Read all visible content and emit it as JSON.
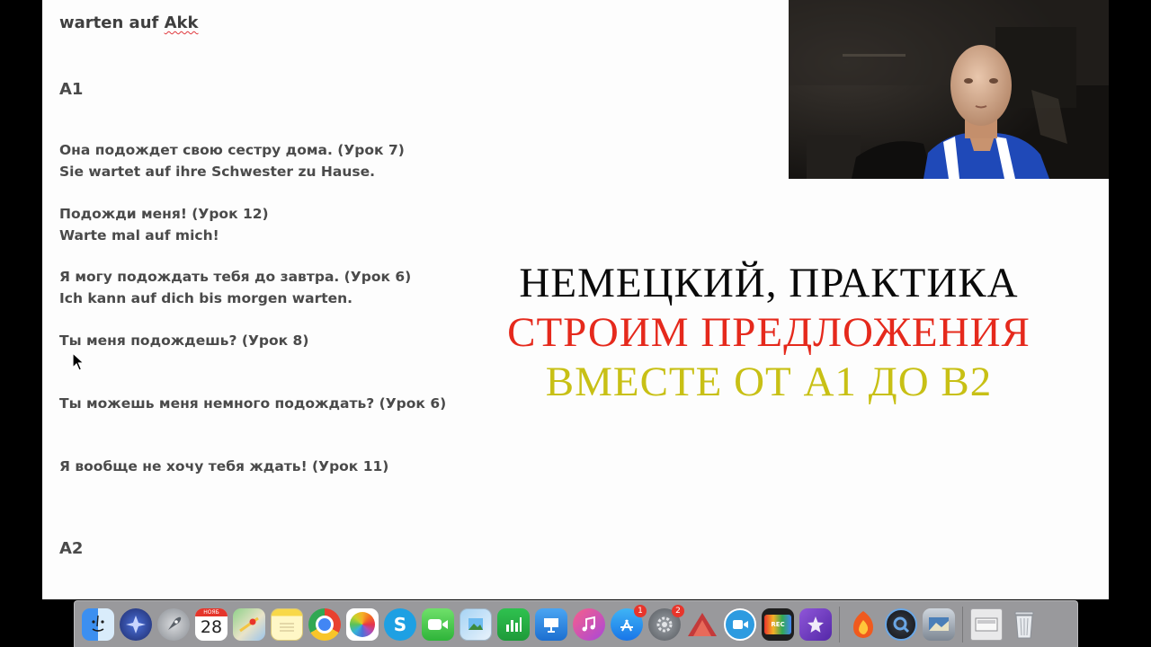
{
  "document": {
    "title_prefix": "warten auf ",
    "title_misspelled": "Akk",
    "levels": [
      "A1",
      "A2"
    ],
    "lines": [
      "Она подождет свою сестру дома. (Урок 7)",
      "Sie wartet auf ihre Schwester zu Hause.",
      "Подожди меня! (Урок 12)",
      "Warte mal auf mich!",
      "Я могу подождать тебя до завтра.  (Урок 6)",
      "Ich kann auf dich bis morgen warten.",
      "Ты меня подождешь? (Урок 8)",
      "Ты можешь меня немного подождать? (Урок 6)",
      "Я вообще не хочу тебя ждать! (Урок 11)"
    ]
  },
  "overlay": {
    "line1": "НЕМЕЦКИЙ, ПРАКТИКА",
    "line2": "СТРОИМ ПРЕДЛОЖЕНИЯ",
    "line3": "ВМЕСТЕ ОТ А1 ДО В2",
    "colors": {
      "line1": "#0a0a0a",
      "line2": "#e5291c",
      "line3": "#c8c015"
    }
  },
  "dock": {
    "calendar": {
      "month": "НОЯБ",
      "day": "28"
    },
    "skype_letter": "S",
    "rec_label": "REC",
    "badges": {
      "app_store": "1",
      "system_preferences": "2"
    },
    "items": [
      "finder-icon",
      "launchpad-icon",
      "rocket-icon",
      "calendar-icon",
      "maps-icon",
      "notes-icon",
      "chrome-icon",
      "photos-icon",
      "skype-icon",
      "facetime-icon",
      "preview-icon",
      "numbers-icon",
      "keynote-icon",
      "music-icon",
      "app-store-icon",
      "system-preferences-icon",
      "affinity-icon",
      "screen-recorder-icon",
      "rec-icon",
      "imovie-icon",
      "hotspot-shield-icon",
      "quicktime-icon",
      "image-capture-icon",
      "downloads-stack-icon",
      "trash-icon"
    ]
  }
}
